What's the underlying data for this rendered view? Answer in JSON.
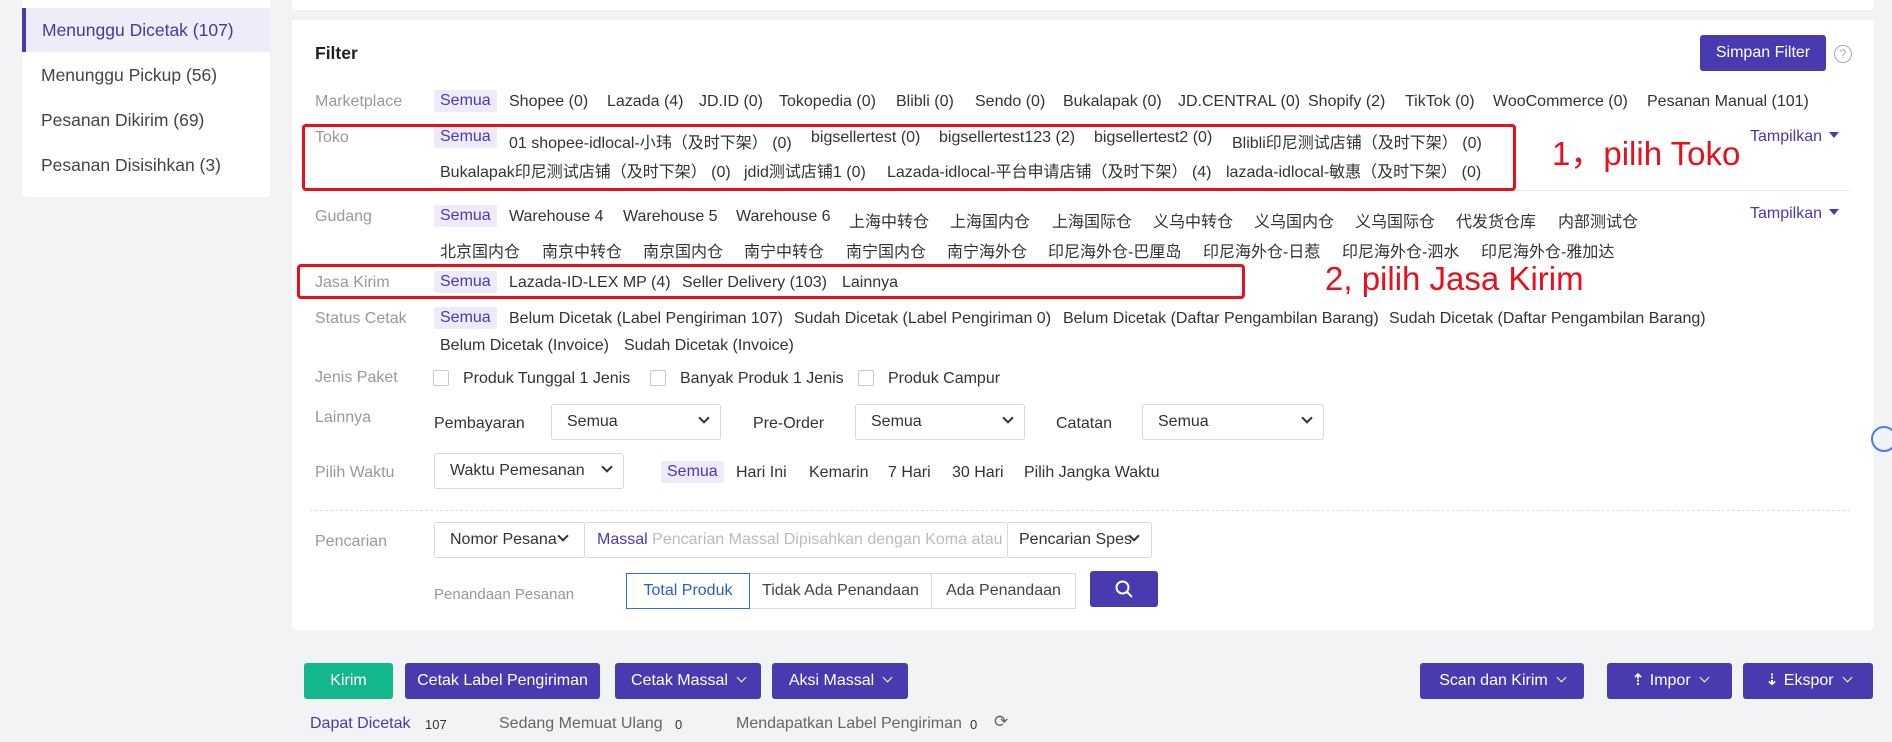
{
  "sidebar": {
    "items": [
      {
        "label": "Menunggu Dicetak (107)"
      },
      {
        "label": "Menunggu Pickup (56)"
      },
      {
        "label": "Pesanan Dikirim (69)"
      },
      {
        "label": "Pesanan Disisihkan (3)"
      }
    ]
  },
  "filter": {
    "title": "Filter",
    "save_label": "Simpan Filter",
    "help_icon": "?",
    "show_label": "Tampilkan",
    "marketplace": {
      "label": "Marketplace",
      "options": [
        "Semua",
        "Shopee (0)",
        "Lazada (4)",
        "JD.ID (0)",
        "Tokopedia (0)",
        "Blibli (0)",
        "Sendo (0)",
        "Bukalapak (0)",
        "JD.CENTRAL (0)",
        "Shopify (2)",
        "TikTok (0)",
        "WooCommerce (0)",
        "Pesanan Manual (101)"
      ]
    },
    "toko": {
      "label": "Toko",
      "options": [
        "Semua",
        "01 shopee-idlocal-小玮（及时下架）  (0)",
        "bigsellertest (0)",
        "bigsellertest123 (2)",
        "bigsellertest2 (0)",
        "Blibli印尼测试店铺（及时下架）  (0)",
        "Bukalapak印尼测试店铺（及时下架）  (0)",
        "jdid测试店铺1 (0)",
        "Lazada-idlocal-平台申请店铺（及时下架）  (4)",
        "lazada-idlocal-敏惠（及时下架）  (0)"
      ]
    },
    "gudang": {
      "label": "Gudang",
      "options": [
        "Semua",
        "Warehouse 4",
        "Warehouse 5",
        "Warehouse 6",
        "上海中转仓",
        "上海国内仓",
        "上海国际仓",
        "义乌中转仓",
        "义乌国内仓",
        "义乌国际仓",
        "代发货仓库",
        "内部测试仓",
        "北京国内仓",
        "南京中转仓",
        "南京国内仓",
        "南宁中转仓",
        "南宁国内仓",
        "南宁海外仓",
        "印尼海外仓-巴厘岛",
        "印尼海外仓-日惹",
        "印尼海外仓-泗水",
        "印尼海外仓-雅加达"
      ]
    },
    "jasa": {
      "label": "Jasa Kirim",
      "options": [
        "Semua",
        "Lazada-ID-LEX MP (4)",
        "Seller Delivery (103)",
        "Lainnya"
      ]
    },
    "status": {
      "label": "Status Cetak",
      "options": [
        "Semua",
        "Belum Dicetak (Label Pengiriman 107)",
        "Sudah Dicetak (Label Pengiriman 0)",
        "Belum Dicetak (Daftar Pengambilan Barang)",
        "Sudah Dicetak (Daftar Pengambilan Barang)",
        "Belum Dicetak (Invoice)",
        "Sudah Dicetak (Invoice)"
      ]
    },
    "jenis": {
      "label": "Jenis Paket",
      "options": [
        "Produk Tunggal 1 Jenis",
        "Banyak Produk 1 Jenis",
        "Produk Campur"
      ]
    },
    "lainnya": {
      "label": "Lainnya",
      "pembayaran_label": "Pembayaran",
      "pembayaran_value": "Semua",
      "preorder_label": "Pre-Order",
      "preorder_value": "Semua",
      "catatan_label": "Catatan",
      "catatan_value": "Semua"
    },
    "waktu": {
      "label": "Pilih Waktu",
      "select_value": "Waktu Pemesanan",
      "options": [
        "Semua",
        "Hari Ini",
        "Kemarin",
        "7 Hari",
        "30 Hari",
        "Pilih Jangka Waktu"
      ]
    },
    "pencarian": {
      "label": "Pencarian",
      "type_value": "Nomor Pesana",
      "massal_label": "Massal",
      "placeholder": "Pencarian Massal Dipisahkan dengan Koma atau S",
      "spec_value": "Pencarian Spes"
    },
    "penandaan": {
      "label": "Penandaan Pesanan",
      "options": [
        "Total Produk",
        "Tidak Ada Penandaan",
        "Ada Penandaan"
      ]
    }
  },
  "annotations": {
    "toko": "1，pilih Toko",
    "jasa": "2, pilih Jasa Kirim"
  },
  "actions": {
    "kirim": "Kirim",
    "cetak_label": "Cetak Label Pengiriman",
    "cetak_massal": "Cetak Massal",
    "aksi_massal": "Aksi Massal",
    "scan": "Scan dan Kirim",
    "impor": "Impor",
    "ekspor": "Ekspor"
  },
  "bottom": {
    "dapat": "Dapat Dicetak",
    "dapat_count": "107",
    "sedang": "Sedang Memuat Ulang",
    "sedang_count": "0",
    "mendapatkan": "Mendapatkan Label Pengiriman",
    "mendapatkan_count": "0"
  },
  "colors": {
    "accent": "#4a3aaf",
    "green": "#13b78b",
    "annotation_red": "#e8101a"
  }
}
